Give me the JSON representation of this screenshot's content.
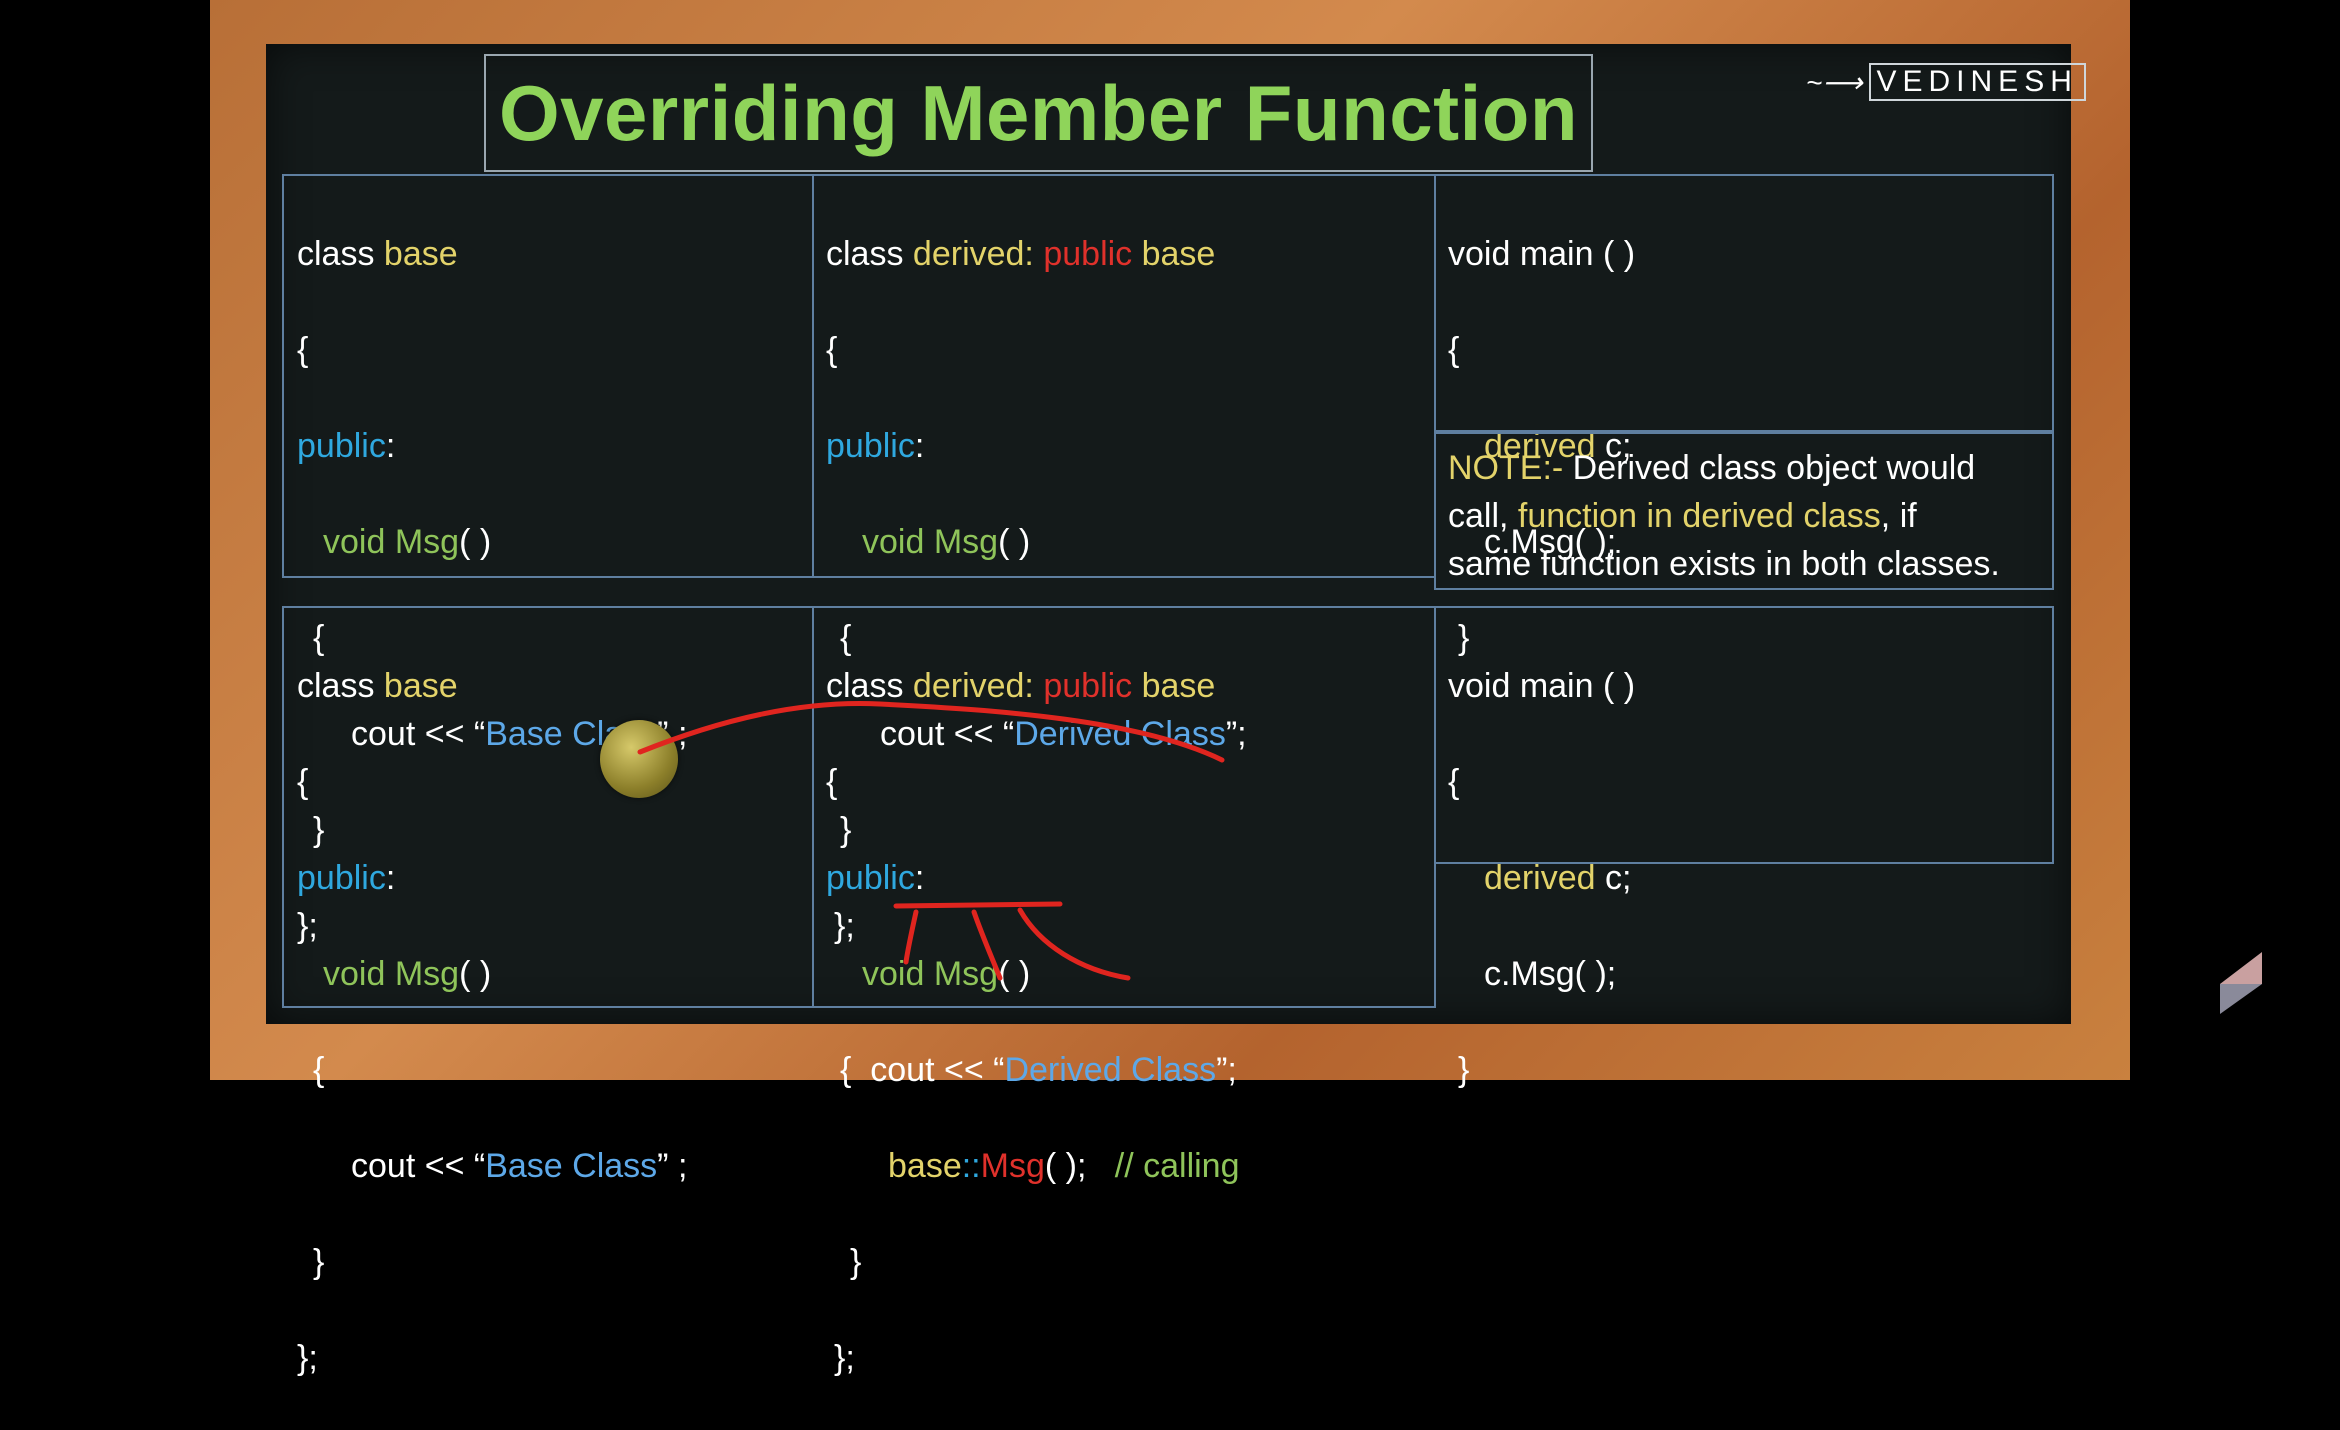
{
  "slide": {
    "title": "Overriding Member Function",
    "logo_text": "VEDINESH",
    "logo_mark": "~⟶"
  },
  "top": {
    "base": {
      "line1_a": "class ",
      "line1_b": "base",
      "line2": "{",
      "line3": "public",
      "line3_colon": ":",
      "line4_a": "void ",
      "line4_b": "Msg",
      "line4_c": "( )",
      "line5": "{",
      "line6_a": "cout << “",
      "line6_b": "Base Class",
      "line6_c": "” ;",
      "line7": "}",
      "line8": "};"
    },
    "derived": {
      "line1_a": "class ",
      "line1_b": "derived:",
      "line1_c": " public",
      "line1_d": " base",
      "line2": "{",
      "line3": "public",
      "line3_colon": ":",
      "line4_a": "void ",
      "line4_b": "Msg",
      "line4_c": "( )",
      "line5": "{",
      "line6_a": "cout << “",
      "line6_b": "Derived Class",
      "line6_c": "”;",
      "line7": "}",
      "line8": "};"
    },
    "main": {
      "line1": "void main ( )",
      "line2": "{",
      "line3_a": "derived",
      "line3_b": " c;",
      "line4": "c.Msg( );",
      "line5": "}"
    }
  },
  "note": {
    "prefix": "NOTE:-",
    "text1": " Derived class object would",
    "text2_a": "call, ",
    "text2_b": "function in derived class",
    "text2_c": ", if",
    "text3": "same function exists in both classes."
  },
  "bottom": {
    "base": {
      "line1_a": "class ",
      "line1_b": "base",
      "line2": "{",
      "line3": "public",
      "line3_colon": ":",
      "line4_a": "void ",
      "line4_b": "Msg",
      "line4_c": "( )",
      "line5": "{",
      "line6_a": "cout << “",
      "line6_b": "Base Class",
      "line6_c": "” ;",
      "line7": "}",
      "line8": "};"
    },
    "derived": {
      "line1_a": "class ",
      "line1_b": "derived:",
      "line1_c": " public",
      "line1_d": " base",
      "line2": "{",
      "line3": "public",
      "line3_colon": ":",
      "line4_a": "void ",
      "line4_b": "Msg",
      "line4_c": "( )",
      "line5_a": "{  cout << “",
      "line5_b": "Derived Class",
      "line5_c": "”;",
      "line6_a": "base",
      "line6_b": "::",
      "line6_c": "Msg",
      "line6_d": "( );   ",
      "line6_e": "// calling",
      "line7": "}",
      "line8": "};"
    },
    "main": {
      "line1": "void main ( )",
      "line2": "{",
      "line3_a": "derived",
      "line3_b": " c;",
      "line4": "c.Msg( );",
      "line5": "}"
    }
  },
  "colors": {
    "title_green": "#8fd45a",
    "keyword_yellow": "#e3d36a",
    "access_blue": "#2fa8df",
    "string_blue": "#5da8e8",
    "accent_red": "#e0312b",
    "board": "#141a1a",
    "frame_wood": "#c57b3e"
  }
}
